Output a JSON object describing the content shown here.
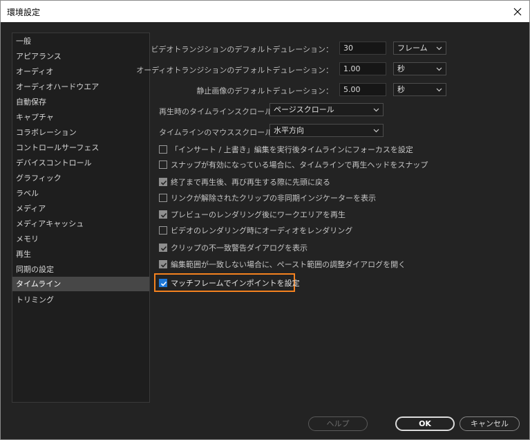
{
  "window": {
    "title": "環境設定"
  },
  "sidebar": {
    "items": [
      {
        "label": "一般"
      },
      {
        "label": "アピアランス"
      },
      {
        "label": "オーディオ"
      },
      {
        "label": "オーディオハードウエア"
      },
      {
        "label": "自動保存"
      },
      {
        "label": "キャプチャ"
      },
      {
        "label": "コラボレーション"
      },
      {
        "label": "コントロールサーフェス"
      },
      {
        "label": "デバイスコントロール"
      },
      {
        "label": "グラフィック"
      },
      {
        "label": "ラベル"
      },
      {
        "label": "メディア"
      },
      {
        "label": "メディアキャッシュ"
      },
      {
        "label": "メモリ"
      },
      {
        "label": "再生"
      },
      {
        "label": "同期の設定"
      },
      {
        "label": "タイムライン"
      },
      {
        "label": "トリミング"
      }
    ],
    "selected": "タイムライン"
  },
  "durations": [
    {
      "label": "ビデオトランジションのデフォルトデュレーション：",
      "value": "30",
      "unit": "フレーム"
    },
    {
      "label": "オーディオトランジションのデフォルトデュレーション：",
      "value": "1.00",
      "unit": "秒"
    },
    {
      "label": "静止画像のデフォルトデュレーション：",
      "value": "5.00",
      "unit": "秒"
    }
  ],
  "scroll": {
    "playback_label": "再生時のタイムラインスクロール：",
    "playback_value": "ページスクロール",
    "mouse_label": "タイムラインのマウススクロール：",
    "mouse_value": "水平方向"
  },
  "checkboxes": [
    {
      "label": "「インサート / 上書き」編集を実行後タイムラインにフォーカスを設定",
      "checked": false
    },
    {
      "label": "スナップが有効になっている場合に、タイムラインで再生ヘッドをスナップ",
      "checked": false
    },
    {
      "label": "終了まで再生後、再び再生する際に先頭に戻る",
      "checked": true
    },
    {
      "label": "リンクが解除されたクリップの非同期インジケーターを表示",
      "checked": false
    },
    {
      "label": "プレビューのレンダリング後にワークエリアを再生",
      "checked": true
    },
    {
      "label": "ビデオのレンダリング時にオーディオをレンダリング",
      "checked": false
    },
    {
      "label": "クリップの不一致警告ダイアログを表示",
      "checked": true
    },
    {
      "label": "編集範囲が一致しない場合に、ペースト範囲の調整ダイアログを開く",
      "checked": true
    },
    {
      "label": "マッチフレームでインポイントを設定",
      "checked": true
    }
  ],
  "footer": {
    "help_label": "ヘルプ",
    "ok_label": "OK",
    "cancel_label": "キャンセル"
  },
  "colors": {
    "accent": "#1e78d8",
    "highlight": "#f5821f",
    "panel": "#232323"
  }
}
